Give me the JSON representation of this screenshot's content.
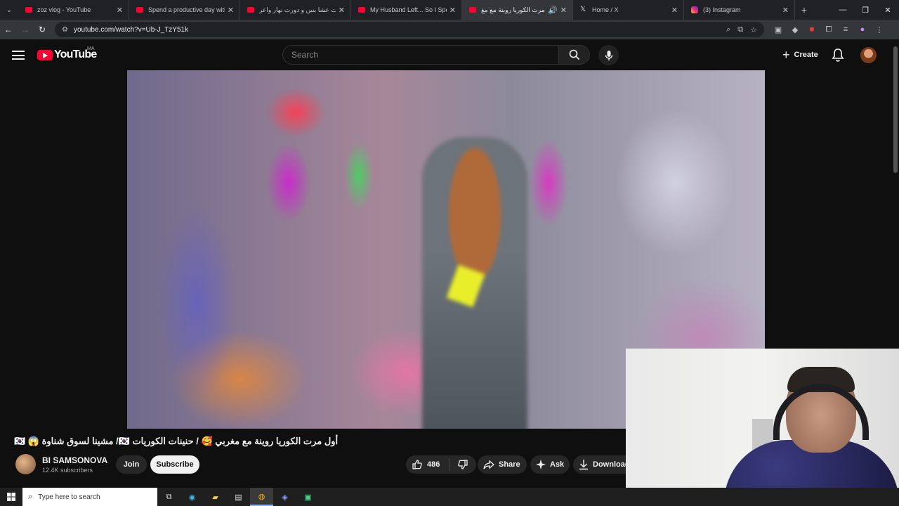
{
  "browser": {
    "tabs": [
      {
        "title": "zoz vlog - YouTube",
        "icon": "youtube-icon",
        "active": false
      },
      {
        "title": "Spend a productive day with m",
        "icon": "youtube-icon",
        "active": false
      },
      {
        "title": "طبيت عشا بنين و دورت نهار واعر",
        "icon": "youtube-icon",
        "active": false
      },
      {
        "title": "My Husband Left... So I Spent a",
        "icon": "youtube-icon",
        "active": false
      },
      {
        "title": "أول مرت الكوريا روينة مع مغ",
        "icon": "youtube-icon",
        "active": true
      },
      {
        "title": "Home / X",
        "icon": "x-icon",
        "active": false
      },
      {
        "title": "(3) Instagram",
        "icon": "instagram-icon",
        "active": false
      }
    ],
    "url": "youtube.com/watch?v=Ub-J_TzY51k"
  },
  "youtube": {
    "logo_text": "YouTube",
    "country_code": "MA",
    "search_placeholder": "Search",
    "create_label": "Create"
  },
  "video": {
    "title": "أول مرت الكوريا روينة مع مغربي 🥰 / حنينات الكوريات 🇰🇷/ مشينا لسوق شناوة 😱 🇰🇷",
    "channel_name": "BI SAMSONOVA",
    "subscribers": "12.4K subscribers",
    "join_label": "Join",
    "subscribe_label": "Subscribe",
    "likes": "486",
    "share_label": "Share",
    "ask_label": "Ask",
    "download_label": "Download"
  },
  "taskbar": {
    "search_placeholder": "Type here to search"
  },
  "colors": {
    "accent_red": "#ff0033",
    "background": "#0f0f0f"
  }
}
